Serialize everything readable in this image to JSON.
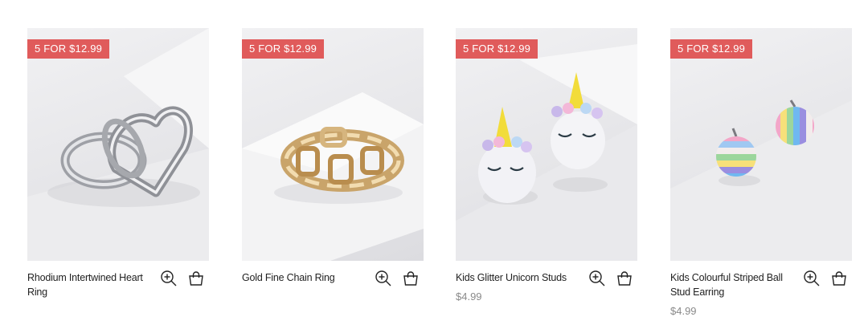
{
  "products": [
    {
      "badge": "5 FOR $12.99",
      "name": "Rhodium Intertwined Heart Ring",
      "price": "",
      "icons": [
        "zoom-in-icon",
        "shopping-bag-icon"
      ]
    },
    {
      "badge": "5 FOR $12.99",
      "name": "Gold Fine Chain Ring",
      "price": "",
      "icons": [
        "zoom-in-icon",
        "shopping-bag-icon"
      ]
    },
    {
      "badge": "5 FOR $12.99",
      "name": "Kids Glitter Unicorn Studs",
      "price": "$4.99",
      "icons": [
        "zoom-in-icon",
        "shopping-bag-icon"
      ]
    },
    {
      "badge": "5 FOR $12.99",
      "name": "Kids Colourful Striped Ball Stud Earring",
      "price": "$4.99",
      "icons": [
        "zoom-in-icon",
        "shopping-bag-icon"
      ]
    }
  ],
  "colors": {
    "badge_bg": "#e05b5b",
    "price_text": "#8a8a8a",
    "name_text": "#222222"
  }
}
